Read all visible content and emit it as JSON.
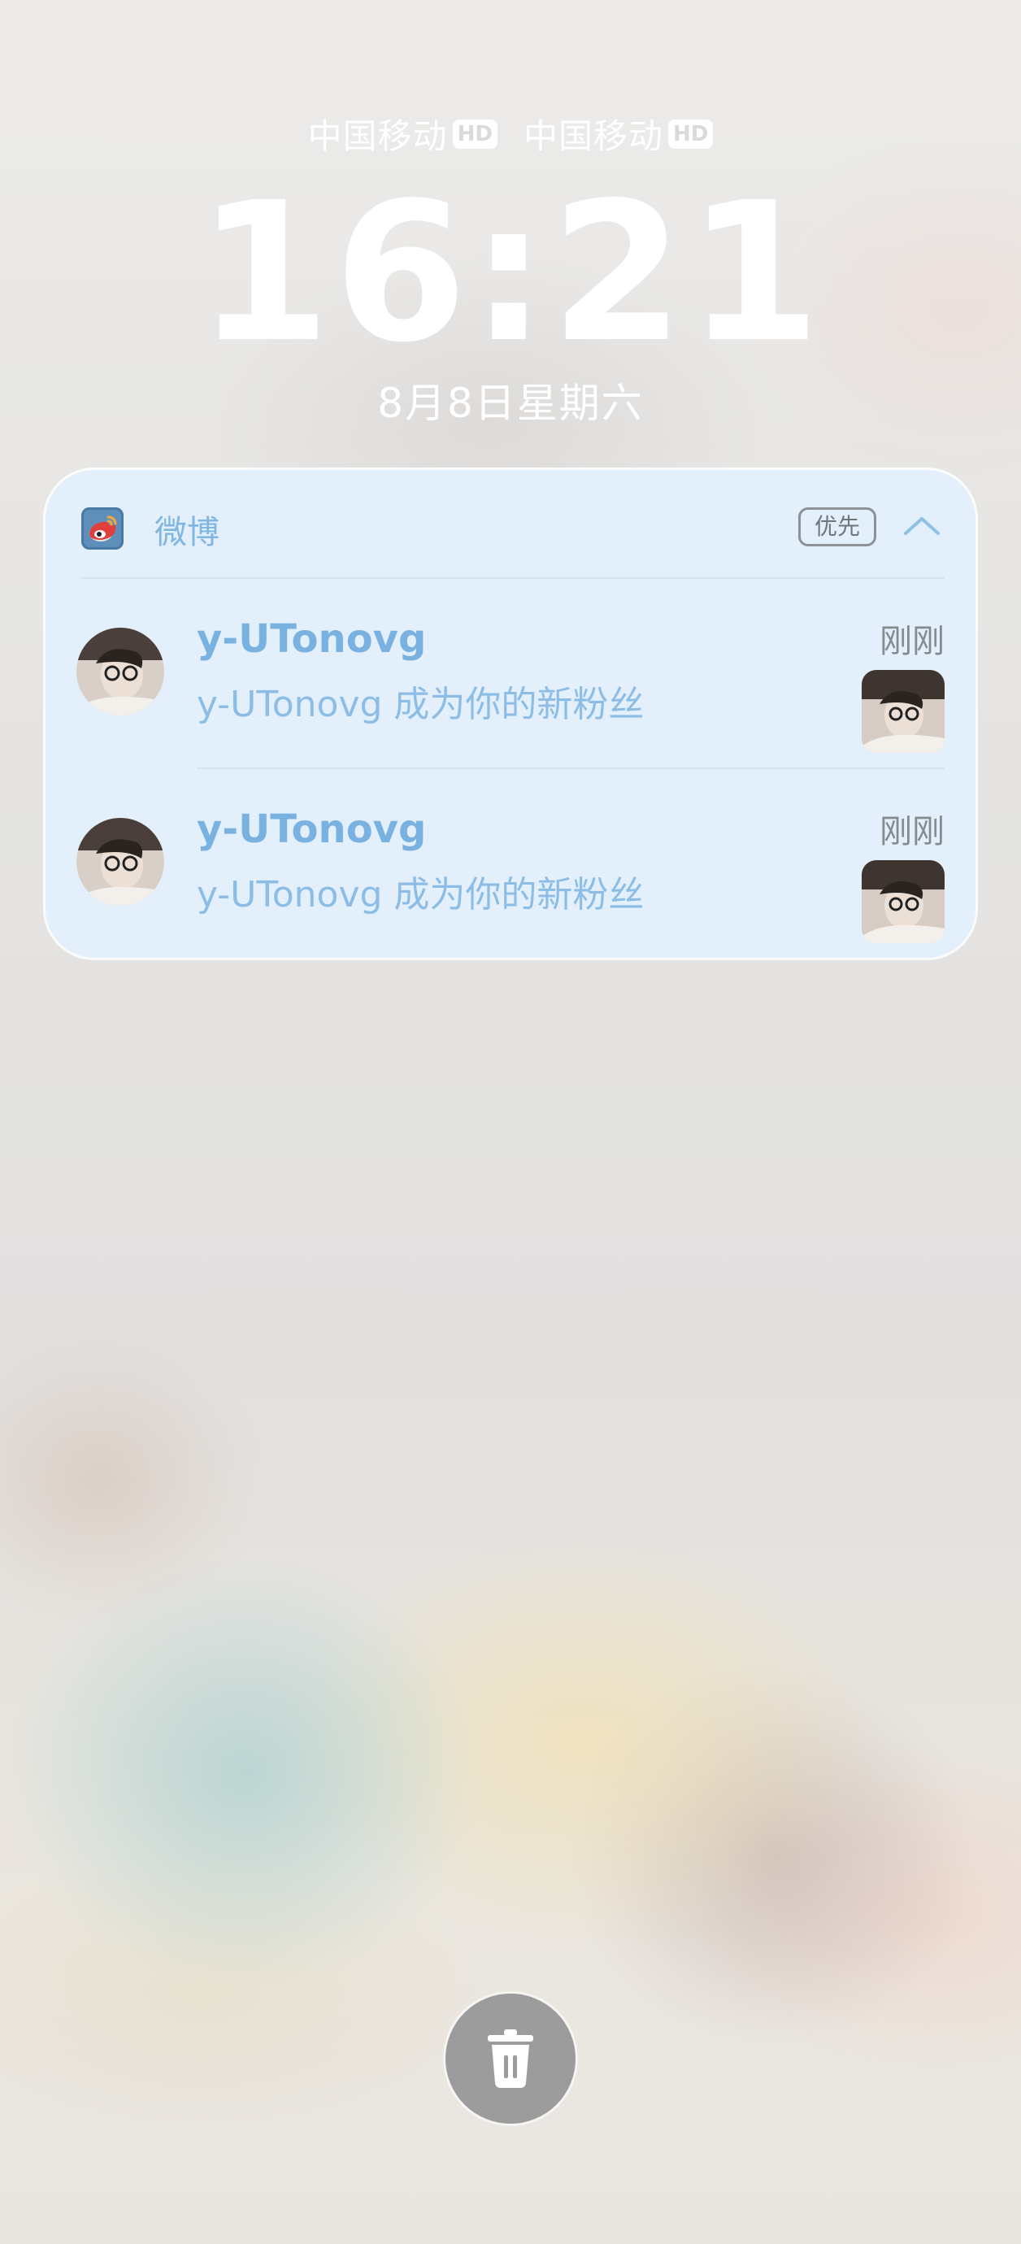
{
  "status": {
    "carriers": [
      {
        "name": "中国移动",
        "badge": "HD"
      },
      {
        "name": "中国移动",
        "badge": "HD"
      }
    ]
  },
  "lockscreen": {
    "time": "16:21",
    "date": "8月8日星期六"
  },
  "notification_group": {
    "app_name": "微博",
    "app_icon": "weibo-icon",
    "priority_label": "优先",
    "collapse_icon": "chevron-up-icon",
    "items": [
      {
        "title": "y-UTonovg",
        "body": "y-UTonovg 成为你的新粉丝",
        "time": "刚刚"
      },
      {
        "title": "y-UTonovg",
        "body": "y-UTonovg 成为你的新粉丝",
        "time": "刚刚"
      }
    ]
  },
  "actions": {
    "clear_icon": "trash-icon"
  },
  "colors": {
    "card_background": "#e3f0fb",
    "accent_text": "#79b2e0",
    "trash_button": "#9c9c9c"
  }
}
